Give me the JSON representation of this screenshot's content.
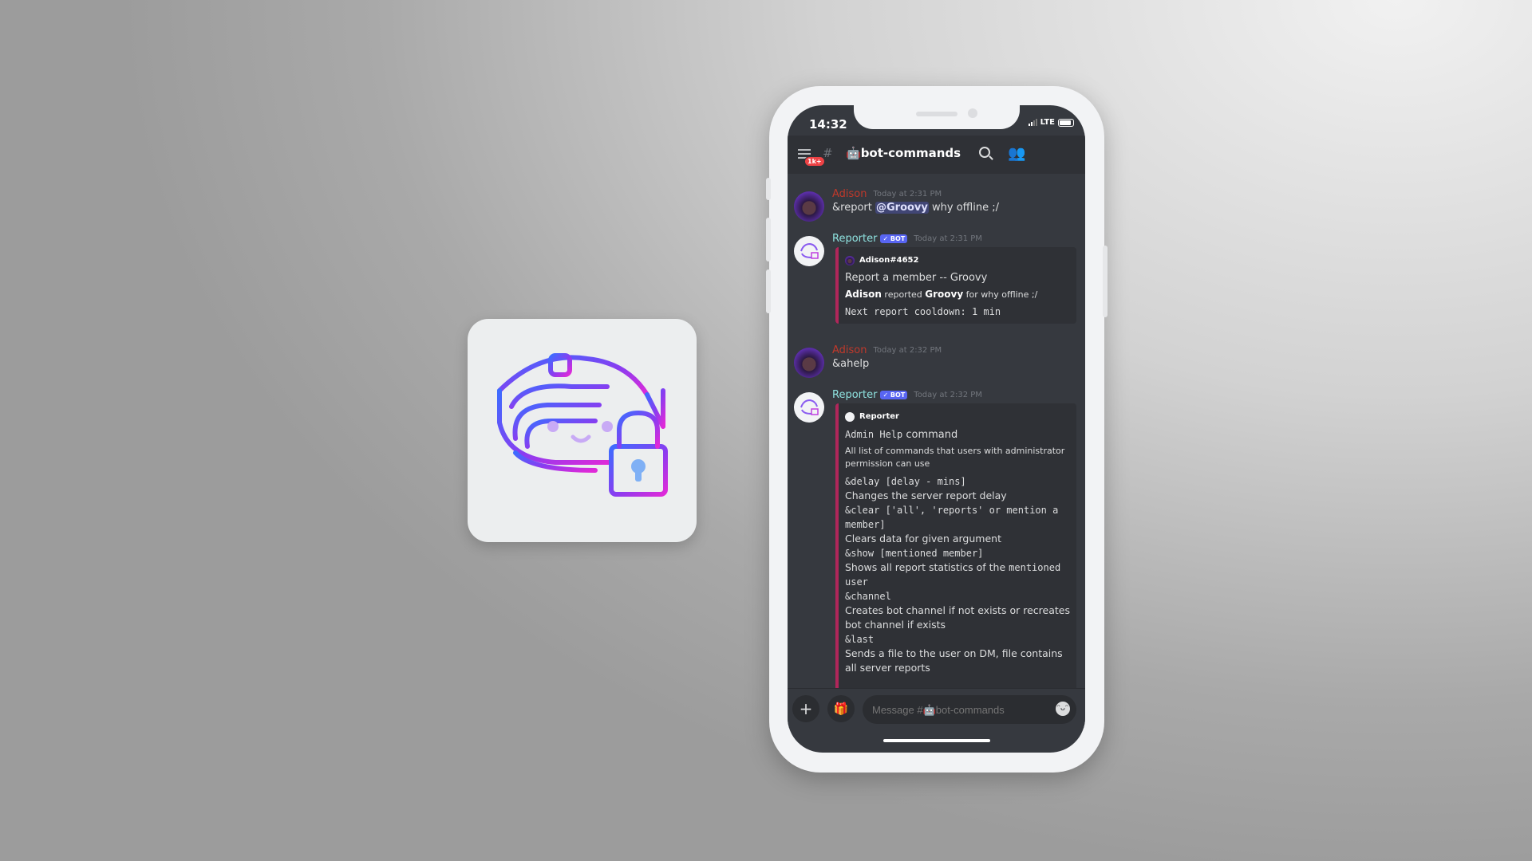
{
  "logo": {
    "name": "reporter-logo"
  },
  "status": {
    "time": "14:32",
    "network": "LTE"
  },
  "header": {
    "badge": "1k+",
    "channel": "bot-commands"
  },
  "messages": [
    {
      "author": "Adison",
      "time": "Today at 2:31 PM",
      "text_prefix": "&report ",
      "mention": "@Groovy",
      "text_suffix": " why offline ;/"
    },
    {
      "author": "Reporter",
      "badge": "✓ BOT",
      "time": "Today at 2:31 PM",
      "embed": {
        "author": "Adison#4652",
        "title": "Report a member -- Groovy",
        "reporter": "Adison",
        "reported_word": " reported ",
        "target": "Groovy",
        "reason": " for why offline ;/",
        "footer": "Next report cooldown: 1 min"
      }
    },
    {
      "author": "Adison",
      "time": "Today at 2:32 PM",
      "text": "&ahelp"
    },
    {
      "author": "Reporter",
      "badge": "✓ BOT",
      "time": "Today at 2:32 PM",
      "embed": {
        "author": "Reporter",
        "title_mono": "Admin Help",
        "title_rest": " command",
        "description": "All list of commands that users with administrator permission can use",
        "commands": [
          {
            "cmd": "&delay [delay - mins]",
            "desc": "Changes the server report delay"
          },
          {
            "cmd": "&clear ['all', 'reports' or mention a member]",
            "desc": "Clears data for given argument"
          },
          {
            "cmd": "&show [mentioned member]",
            "desc": "Shows all report statistics of the ",
            "desc_mono": "mentioned user"
          },
          {
            "cmd": "&channel",
            "desc": "Creates bot channel if not exists or recreates bot channel if exists"
          },
          {
            "cmd": "&last",
            "desc": "Sends a file to the user on DM, file contains all server reports"
          }
        ]
      }
    }
  ],
  "input": {
    "placeholder": "Message #🤖bot-commands"
  },
  "colors": {
    "accent": "#5865f2",
    "embed_border": "#b0265a",
    "user_name": "#c0392b",
    "bot_name": "#8fe3e0"
  }
}
